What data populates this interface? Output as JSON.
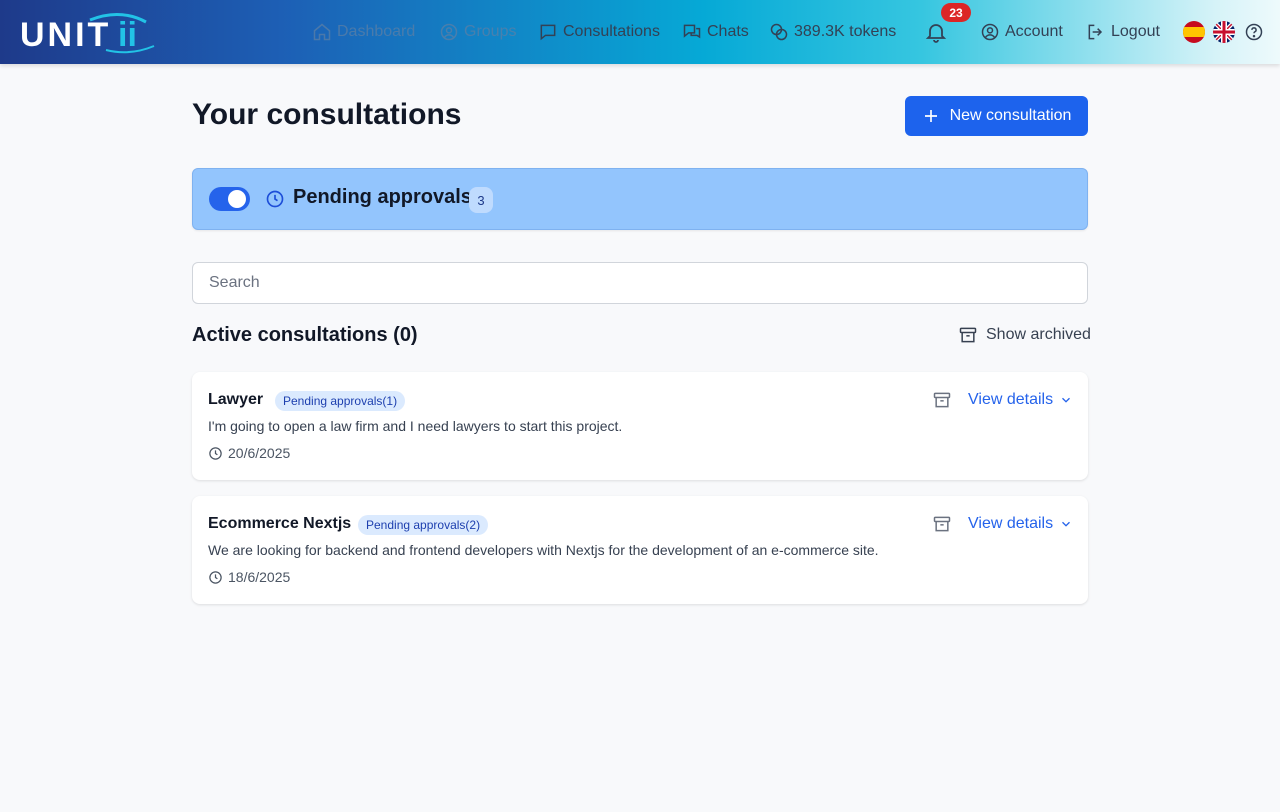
{
  "app": {
    "logo_text": "UNITii"
  },
  "nav": {
    "dashboard": "Dashboard",
    "groups": "Groups",
    "consultations": "Consultations",
    "chats": "Chats",
    "tokens": "389.3K tokens",
    "notifications_count": "23",
    "account": "Account",
    "logout": "Logout",
    "languages": [
      "es-flag-icon",
      "uk-flag-icon"
    ]
  },
  "main": {
    "title": "Your consultations",
    "new_button": "New consultation",
    "pending": {
      "label": "Pending approvals",
      "count": "3",
      "toggle_on": true
    },
    "search": {
      "placeholder": "Search",
      "value": ""
    },
    "section_title": "Active consultations (0)",
    "show_archived": "Show archived",
    "consultations": [
      {
        "title": "Lawyer",
        "badge": "Pending approvals(1)",
        "description": "I'm going to open a law firm and I need lawyers to start this project.",
        "date": "20/6/2025",
        "action": "View details"
      },
      {
        "title": "Ecommerce Nextjs",
        "badge": "Pending approvals(2)",
        "description": "We are looking for backend and frontend developers with Nextjs for the development of an e-commerce site.",
        "date": "18/6/2025",
        "action": "View details"
      }
    ]
  },
  "colors": {
    "primary": "#1d63ed",
    "pending_bg": "#93c5fd",
    "badge_bg": "#dbeafe",
    "notification": "#dc2626"
  }
}
